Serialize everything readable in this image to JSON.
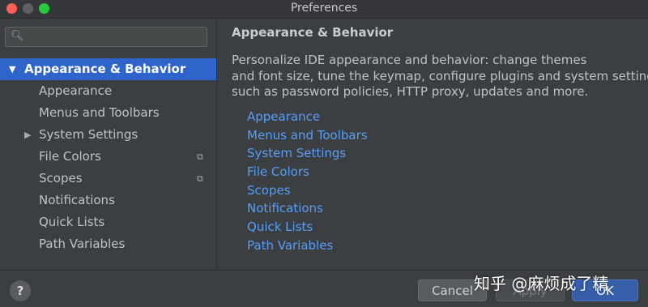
{
  "window": {
    "title": "Preferences"
  },
  "sidebar": {
    "search": {
      "value": "",
      "placeholder": ""
    },
    "items": [
      {
        "label": "Appearance & Behavior"
      },
      {
        "label": "Appearance"
      },
      {
        "label": "Menus and Toolbars"
      },
      {
        "label": "System Settings"
      },
      {
        "label": "File Colors"
      },
      {
        "label": "Scopes"
      },
      {
        "label": "Notifications"
      },
      {
        "label": "Quick Lists"
      },
      {
        "label": "Path Variables"
      }
    ]
  },
  "main": {
    "title": "Appearance & Behavior",
    "description": [
      "Personalize IDE appearance and behavior: change themes",
      "and font size, tune the keymap, configure plugins and system settings,",
      "such as password policies, HTTP proxy, updates and more."
    ],
    "links": [
      "Appearance",
      "Menus and Toolbars",
      "System Settings",
      "File Colors",
      "Scopes",
      "Notifications",
      "Quick Lists",
      "Path Variables"
    ]
  },
  "footer": {
    "help_label": "?",
    "cancel_label": "Cancel",
    "apply_label": "Apply",
    "ok_label": "OK"
  },
  "watermark": "知乎 @麻烦成了精",
  "icons": {
    "search": "search-icon",
    "expand_down": "triangle-down-icon",
    "expand_right": "triangle-right-icon",
    "copy": "copy-icon"
  },
  "colors": {
    "selection": "#2f65ca",
    "link": "#589df6",
    "ok_button": "#375ea8"
  }
}
